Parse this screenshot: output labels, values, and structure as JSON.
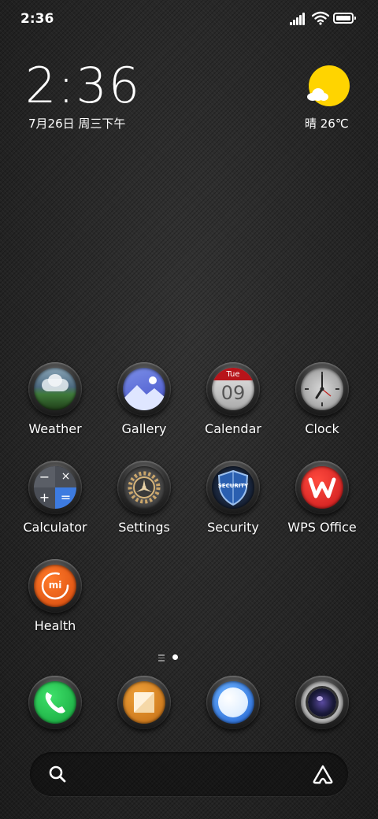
{
  "status_bar": {
    "time": "2:36"
  },
  "widget": {
    "clock": "2:36",
    "date": "7月26日 周三下午",
    "weather": "晴 26℃"
  },
  "apps": [
    {
      "label": "Weather",
      "icon": "weather-icon"
    },
    {
      "label": "Gallery",
      "icon": "gallery-icon"
    },
    {
      "label": "Calendar",
      "icon": "calendar-icon",
      "day": "Tue",
      "date": "09"
    },
    {
      "label": "Clock",
      "icon": "clock-icon"
    },
    {
      "label": "Calculator",
      "icon": "calculator-icon"
    },
    {
      "label": "Settings",
      "icon": "gear-icon"
    },
    {
      "label": "Security",
      "icon": "shield-icon",
      "badge": "SECURITY"
    },
    {
      "label": "WPS Office",
      "icon": "wps-icon"
    },
    {
      "label": "Health",
      "icon": "health-icon",
      "badge": "mi"
    }
  ],
  "dock": [
    {
      "icon": "phone-icon"
    },
    {
      "icon": "notes-icon"
    },
    {
      "icon": "browser-icon"
    },
    {
      "icon": "camera-icon"
    }
  ],
  "search_bar": {
    "left_icon": "search-icon",
    "right_icon": "assistant-icon"
  },
  "colors": {
    "weather_sun": "#ffd400",
    "phone": "#1fbf4a",
    "notes": "#e8952a",
    "wps": "#d8201c",
    "health": "#e35a12",
    "calculator": "#3d7be0"
  }
}
